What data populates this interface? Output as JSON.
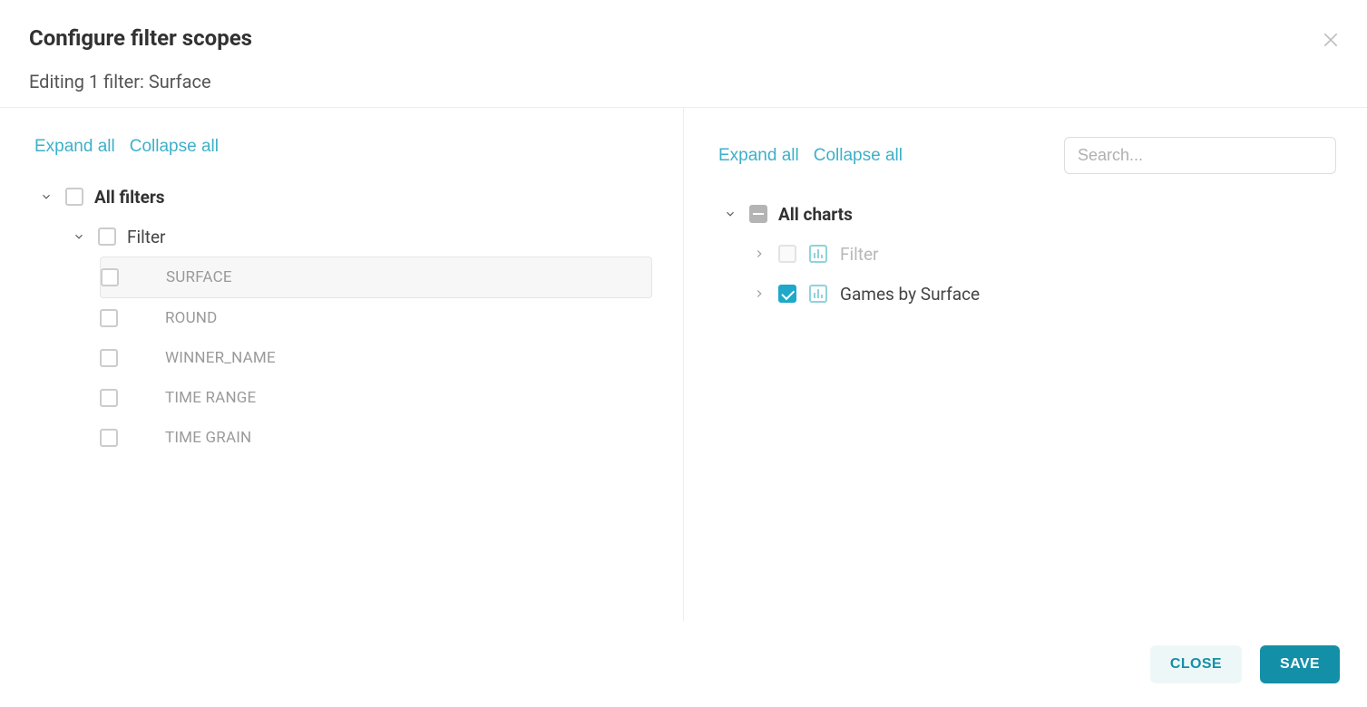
{
  "title": "Configure filter scopes",
  "subtitle": "Editing 1 filter: Surface",
  "actions": {
    "expand": "Expand all",
    "collapse": "Collapse all"
  },
  "search": {
    "placeholder": "Search..."
  },
  "left": {
    "root_label": "All filters",
    "filter_group_label": "Filter",
    "items": [
      {
        "label": "SURFACE",
        "selected": true
      },
      {
        "label": "ROUND",
        "selected": false
      },
      {
        "label": "WINNER_NAME",
        "selected": false
      },
      {
        "label": "TIME RANGE",
        "selected": false
      },
      {
        "label": "TIME GRAIN",
        "selected": false
      }
    ]
  },
  "right": {
    "root_label": "All charts",
    "items": [
      {
        "label": "Filter",
        "checked": false,
        "disabled": true
      },
      {
        "label": "Games by Surface",
        "checked": true,
        "disabled": false
      }
    ]
  },
  "footer": {
    "close": "CLOSE",
    "save": "SAVE"
  }
}
